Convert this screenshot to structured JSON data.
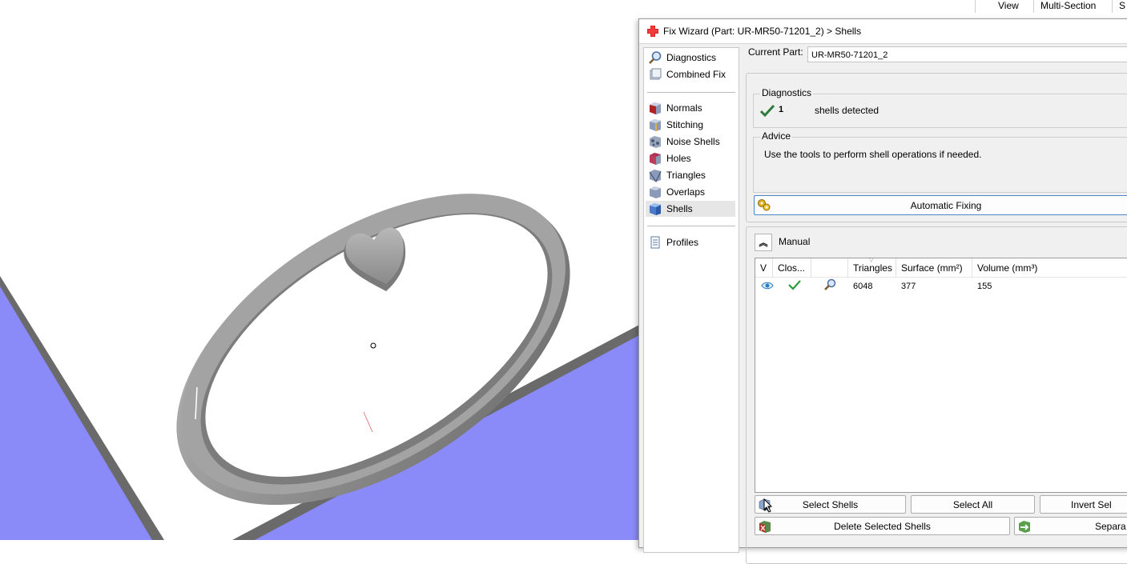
{
  "top_tabs": [
    "View",
    "Multi-Section",
    "S"
  ],
  "dialog": {
    "title": "Fix Wizard (Part: UR-MR50-71201_2) > Shells",
    "nav": {
      "group1": [
        {
          "label": "Diagnostics",
          "icon": "magnifier-icon"
        },
        {
          "label": "Combined Fix",
          "icon": "combined-fix-icon"
        }
      ],
      "group2": [
        {
          "label": "Normals",
          "icon": "normals-icon"
        },
        {
          "label": "Stitching",
          "icon": "stitching-icon"
        },
        {
          "label": "Noise Shells",
          "icon": "noise-shells-icon"
        },
        {
          "label": "Holes",
          "icon": "holes-icon"
        },
        {
          "label": "Triangles",
          "icon": "triangles-icon"
        },
        {
          "label": "Overlaps",
          "icon": "overlaps-icon"
        },
        {
          "label": "Shells",
          "icon": "shells-icon"
        }
      ],
      "group3": [
        {
          "label": "Profiles",
          "icon": "profiles-icon"
        }
      ],
      "selected": "Shells"
    },
    "current_part_label": "Current Part:",
    "current_part_value": "UR-MR50-71201_2",
    "diagnostics": {
      "title": "Diagnostics",
      "count": "1",
      "text": "shells detected"
    },
    "advice": {
      "title": "Advice",
      "text": "Use the tools to perform shell operations if needed."
    },
    "automatic_fixing_label": "Automatic Fixing",
    "manual_label": "Manual",
    "table": {
      "columns": [
        "V",
        "Clos...",
        "",
        "Triangles",
        "Surface (mm²)",
        "Volume (mm³)"
      ],
      "rows": [
        {
          "visible": "eye-icon",
          "closed": "check-icon",
          "action": "magnifier-icon",
          "triangles": "6048",
          "surface": "377",
          "volume": "155"
        }
      ]
    },
    "buttons": {
      "select_shells": "Select Shells",
      "select_all": "Select All",
      "invert_sel": "Invert Sel",
      "delete_selected": "Delete Selected Shells",
      "separate": "Separa"
    }
  },
  "colors": {
    "plane": "#8a8af8",
    "ring": "#8c8c8c",
    "accent_blue": "#4a86c8",
    "check_green": "#2e9a3e"
  }
}
